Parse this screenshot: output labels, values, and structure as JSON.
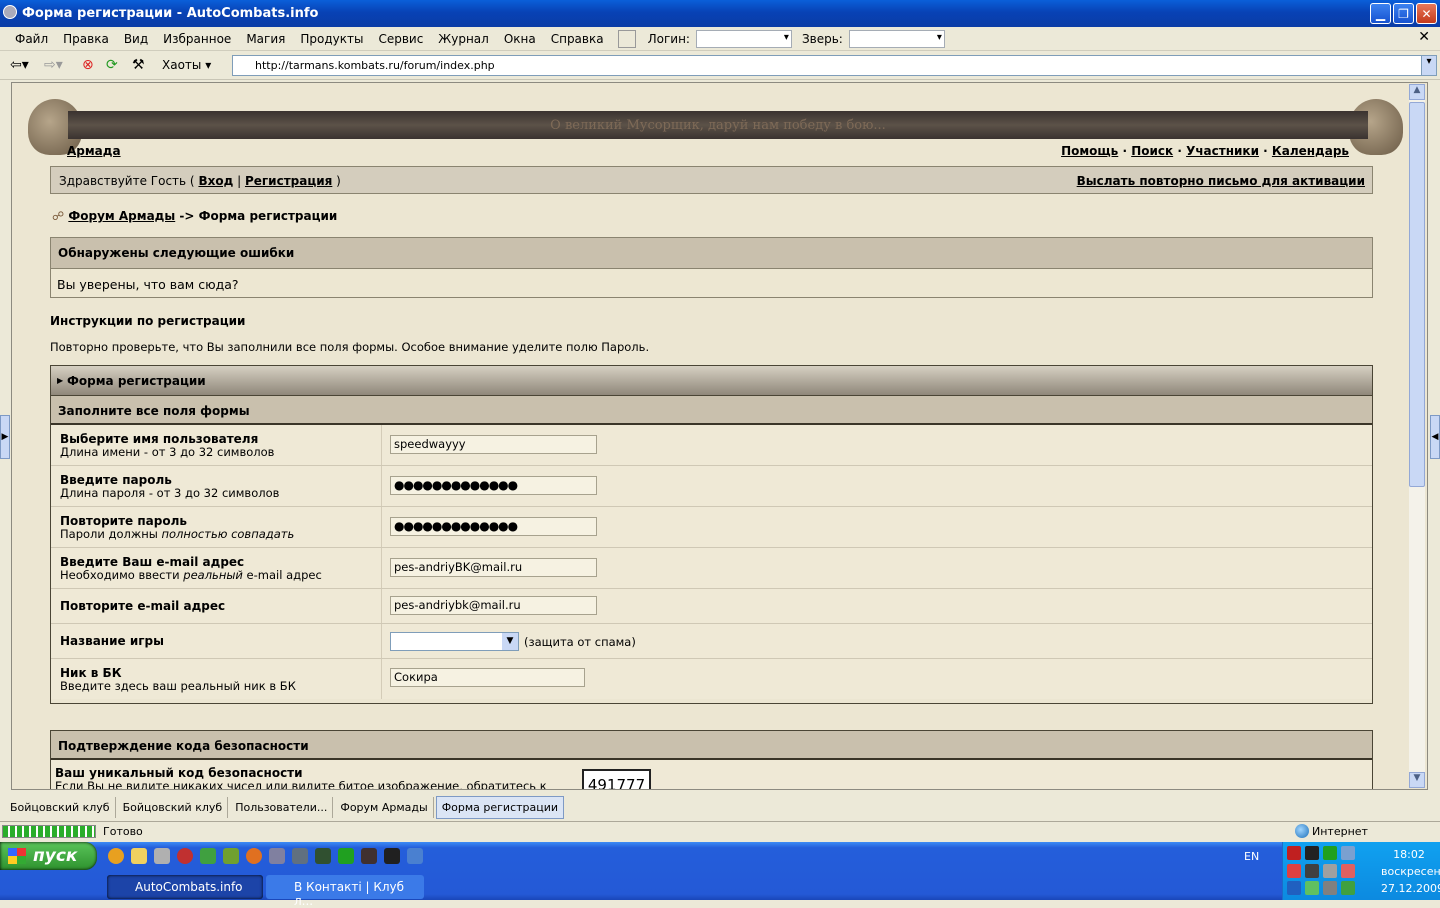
{
  "window": {
    "title": "Форма регистрации - AutoCombats.info"
  },
  "menu": {
    "items": [
      "Файл",
      "Правка",
      "Вид",
      "Избранное",
      "Магия",
      "Продукты",
      "Сервис",
      "Журнал",
      "Окна",
      "Справка"
    ],
    "login_label": "Логин:",
    "beast_label": "Зверь:"
  },
  "toolbar": {
    "haoty": "Хаоты",
    "url": "http://tarmans.kombats.ru/forum/index.php"
  },
  "banner": {
    "motto": "О великий Мусорщик, даруй нам победу в бою..."
  },
  "nav": {
    "home": "Армада",
    "help": "Помощь",
    "search": "Поиск",
    "members": "Участники",
    "calendar": "Календарь"
  },
  "userbar": {
    "greeting": "Здравствуйте Гость (",
    "login": "Вход",
    "sep": "|",
    "register": "Регистрация",
    "close": ")",
    "resend": "Выслать повторно письмо для активации"
  },
  "breadcrumb": {
    "forum": "Форум Армады",
    "arrow": "->",
    "current": "Форма регистрации"
  },
  "errors": {
    "title": "Обнаружены следующие ошибки",
    "message": "Вы уверены, что вам сюда?"
  },
  "instructions": {
    "title": "Инструкции по регистрации",
    "text": "Повторно проверьте, что Вы заполнили все поля формы. Особое внимание уделите полю Пароль."
  },
  "form": {
    "title": "Форма регистрации",
    "subtitle": "Заполните все поля формы",
    "username": {
      "label": "Выберите имя пользователя",
      "hint": "Длина имени - от 3 до 32 символов",
      "value": "speedwayyy"
    },
    "password": {
      "label": "Введите пароль",
      "hint": "Длина пароля - от 3 до 32 символов",
      "value": "●●●●●●●●●●●●●"
    },
    "password2": {
      "label": "Повторите пароль",
      "hint_a": "Пароли должны ",
      "hint_b": "полностью совпадать",
      "value": "●●●●●●●●●●●●●"
    },
    "email": {
      "label": "Введите Ваш e-mail адрес",
      "hint_a": "Необходимо ввести ",
      "hint_b": "реальный",
      "hint_c": " e-mail адрес",
      "value": "pes-andriyBK@mail.ru"
    },
    "email2": {
      "label": "Повторите e-mail адрес",
      "value": "pes-andriybk@mail.ru"
    },
    "game": {
      "label": "Название игры",
      "selected": "",
      "note": "(защита от спама)"
    },
    "nick": {
      "label": "Ник в БК",
      "hint": "Введите здесь ваш реальный ник в БК",
      "value": "Сокира"
    }
  },
  "security": {
    "title": "Подтверждение кода безопасности",
    "label": "Ваш уникальный код безопасности",
    "hint": "Если Вы не видите никаких чисел или видите битое изображение, обратитесь к",
    "code": "491777"
  },
  "tabs": [
    "Бойцовский клуб",
    "Бойцовский клуб",
    "Пользователи...",
    "Форум Армады",
    "Форма регистрации"
  ],
  "status": {
    "text": "Готово",
    "zone": "Интернет",
    "progress": 1.0
  },
  "taskbar": {
    "start": "пуск",
    "windows": [
      "AutoCombats.info",
      "В Контакті | Клуб л..."
    ],
    "lang": "EN",
    "time": "18:02",
    "day": "воскресенье",
    "date": "27.12.2009"
  }
}
